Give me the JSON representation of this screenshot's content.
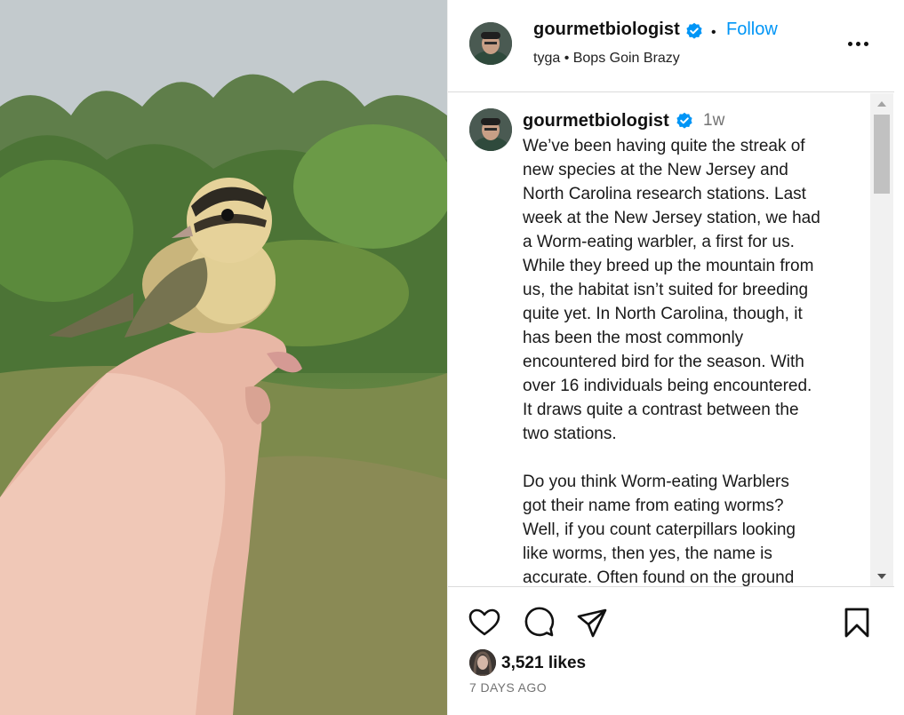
{
  "post": {
    "username": "gourmetbiologist",
    "follow_label": "Follow",
    "separator": "•",
    "audio": "tyga • Bops Goin Brazy",
    "time_ago": "1w",
    "caption": "We’ve been having quite the streak of\nnew species at the New Jersey and\nNorth Carolina research stations. Last\nweek at the New Jersey station, we had\na Worm-eating warbler, a first for us.\nWhile they breed up the mountain from\nus, the habitat isn’t suited for breeding\nquite yet. In North Carolina, though, it\nhas been the most commonly\nencountered bird for the season. With\nover 16 individuals being encountered.\nIt draws quite a contrast between the\ntwo stations.\n\nDo you think Worm-eating Warblers\ngot their name from eating worms?\nWell, if you count caterpillars looking\nlike worms, then yes, the name is\naccurate. Often found on the ground\nforaging for caterpillars and other",
    "likes": "3,521 likes",
    "date": "7 DAYS AGO"
  },
  "icons": {
    "verified": "verified-badge-icon",
    "more": "more-options-icon",
    "like": "heart-icon",
    "comment": "comment-icon",
    "share": "send-icon",
    "save": "bookmark-icon"
  },
  "colors": {
    "accent": "#0095f6",
    "verified": "#0095f6",
    "secondary_text": "#737373",
    "border": "#dbdbdb"
  }
}
